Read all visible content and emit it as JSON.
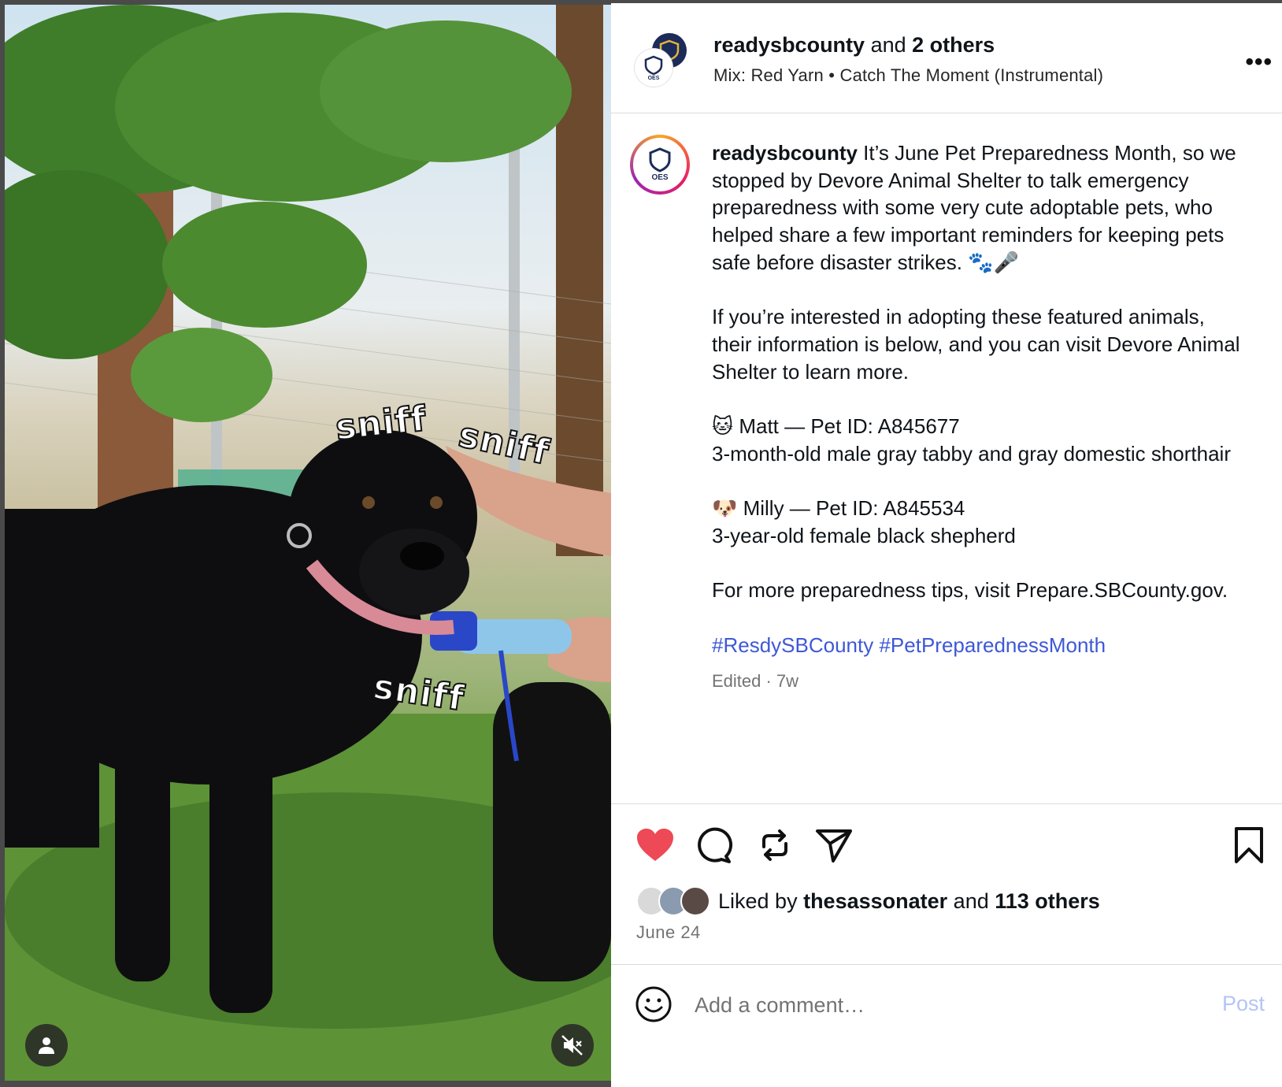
{
  "header": {
    "username": "readysbcounty",
    "and_text": " and ",
    "others": "2 others",
    "audio": "Mix: Red Yarn • Catch The Moment (Instrumental)",
    "avatar_label": "OES",
    "more_icon": "more-horizontal-icon"
  },
  "media": {
    "overlay_texts": [
      "sniff",
      "sniff",
      "sniff"
    ],
    "user_icon": "user-tag-icon",
    "mute_icon": "speaker-muted-icon"
  },
  "caption": {
    "avatar_label": "OES",
    "username": "readysbcounty",
    "paragraph1": " It’s June Pet Preparedness Month, so we stopped by Devore Animal Shelter to talk emergency preparedness with some very cute adoptable pets, who helped share a few important reminders for keeping pets safe before disaster strikes. 🐾🎤",
    "paragraph2": "If you’re interested in adopting these featured animals, their information is below, and you can visit Devore Animal Shelter to learn more.",
    "pet1_line1": "🐱 Matt — Pet ID: A845677",
    "pet1_line2": "3-month-old male gray tabby and gray domestic shorthair",
    "pet2_line1": "🐶 Milly — Pet ID: A845534",
    "pet2_line2": "3-year-old female black shepherd",
    "paragraph3": "For more preparedness tips, visit Prepare.SBCounty.gov.",
    "hashtag1": "#ResdySBCounty",
    "hashtag2": "#PetPreparednessMonth",
    "meta": "Edited · 7w"
  },
  "actions": {
    "like_icon": "heart-filled-icon",
    "comment_icon": "comment-icon",
    "repost_icon": "repost-icon",
    "share_icon": "send-icon",
    "save_icon": "bookmark-icon",
    "like_color": "#ed4956",
    "liked_prefix": "Liked by ",
    "liked_user": "thesassonater",
    "liked_and": " and ",
    "liked_others": "113 others",
    "date": "June 24"
  },
  "comment": {
    "placeholder": "Add a comment…",
    "post_label": "Post",
    "emoji_icon": "smiley-icon"
  }
}
